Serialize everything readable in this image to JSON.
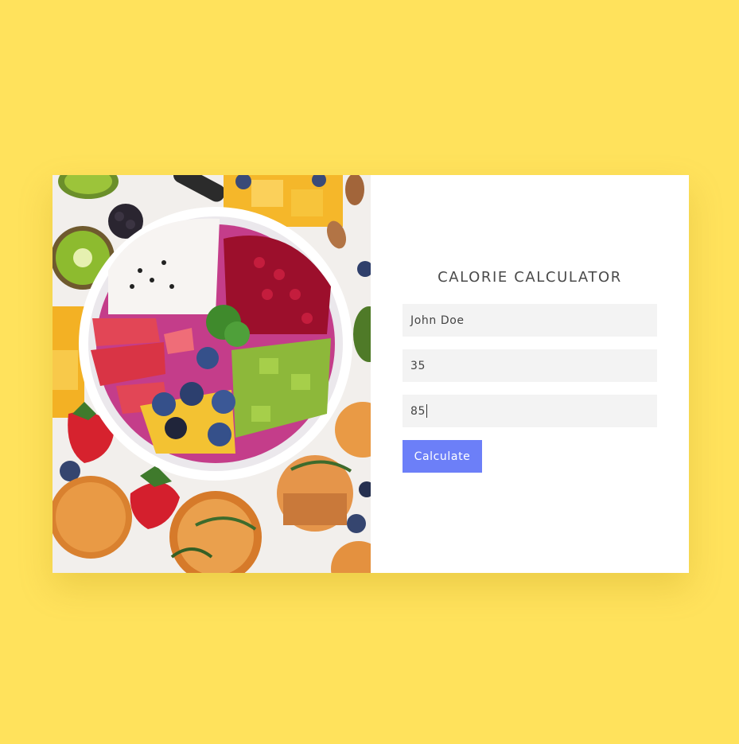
{
  "calculator": {
    "title": "CALORIE CALCULATOR",
    "name_value": "John Doe",
    "age_value": "35",
    "weight_value": "85",
    "button_label": "Calculate"
  },
  "colors": {
    "background": "#FFE25C",
    "card": "#FFFFFF",
    "field": "#F3F3F3",
    "button": "#6C7FF8",
    "title": "#4A4A4A"
  },
  "image": {
    "icon": "fruit-bowl-photo"
  }
}
